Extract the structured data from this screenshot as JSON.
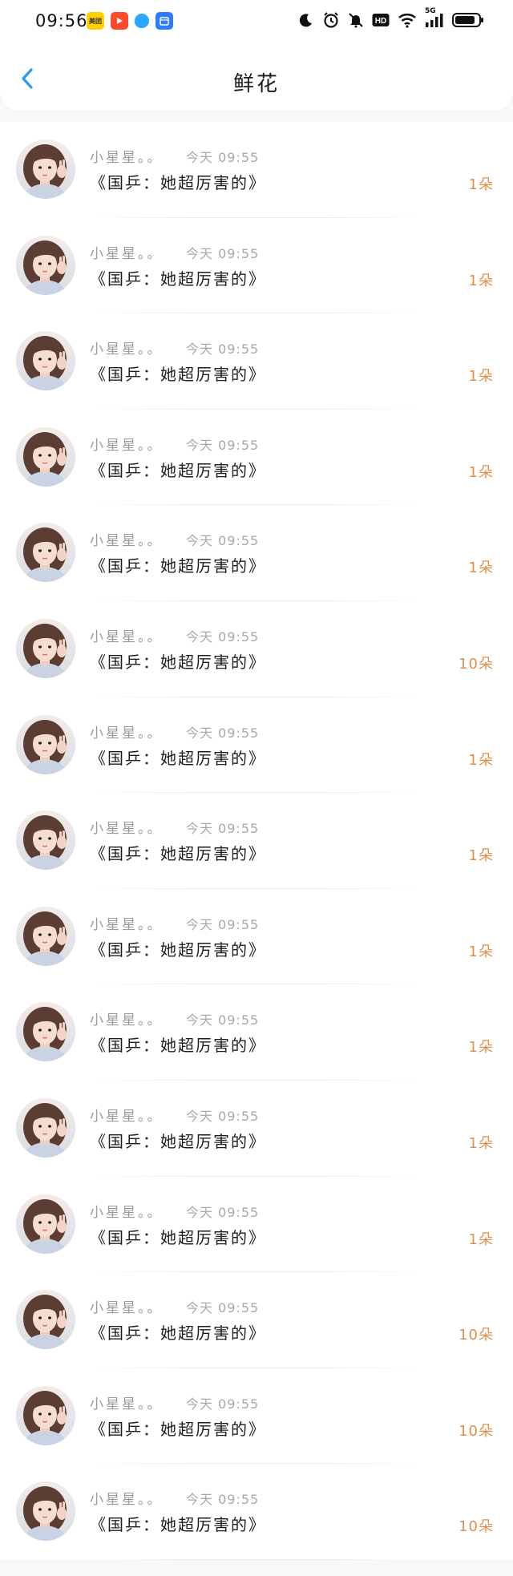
{
  "status_bar": {
    "time": "09:56",
    "app_icons": [
      {
        "name": "meituan-icon",
        "label": "美团"
      },
      {
        "name": "video-app-icon",
        "label": ""
      },
      {
        "name": "message-app-icon",
        "label": ""
      },
      {
        "name": "calendar-app-icon",
        "label": ""
      }
    ],
    "status_icons": [
      "moon-icon",
      "alarm-icon",
      "mute-icon",
      "hd-icon",
      "wifi-icon",
      "signal-icon",
      "battery-icon"
    ],
    "network_label": "5G",
    "hd_label": "HD"
  },
  "header": {
    "title": "鲜花",
    "back_icon": "chevron-left-icon",
    "accent_color": "#2a9bf5"
  },
  "colors": {
    "count": "#e0904a",
    "meta": "#9a9a9a",
    "title": "#1e1e1e"
  },
  "items": [
    {
      "user": "小星星。。",
      "time": "今天 09:55",
      "title": "《国乒：她超厉害的》",
      "count": "1朵"
    },
    {
      "user": "小星星。。",
      "time": "今天 09:55",
      "title": "《国乒：她超厉害的》",
      "count": "1朵"
    },
    {
      "user": "小星星。。",
      "time": "今天 09:55",
      "title": "《国乒：她超厉害的》",
      "count": "1朵"
    },
    {
      "user": "小星星。。",
      "time": "今天 09:55",
      "title": "《国乒：她超厉害的》",
      "count": "1朵"
    },
    {
      "user": "小星星。。",
      "time": "今天 09:55",
      "title": "《国乒：她超厉害的》",
      "count": "1朵"
    },
    {
      "user": "小星星。。",
      "time": "今天 09:55",
      "title": "《国乒：她超厉害的》",
      "count": "10朵"
    },
    {
      "user": "小星星。。",
      "time": "今天 09:55",
      "title": "《国乒：她超厉害的》",
      "count": "1朵"
    },
    {
      "user": "小星星。。",
      "time": "今天 09:55",
      "title": "《国乒：她超厉害的》",
      "count": "1朵"
    },
    {
      "user": "小星星。。",
      "time": "今天 09:55",
      "title": "《国乒：她超厉害的》",
      "count": "1朵"
    },
    {
      "user": "小星星。。",
      "time": "今天 09:55",
      "title": "《国乒：她超厉害的》",
      "count": "1朵"
    },
    {
      "user": "小星星。。",
      "time": "今天 09:55",
      "title": "《国乒：她超厉害的》",
      "count": "1朵"
    },
    {
      "user": "小星星。。",
      "time": "今天 09:55",
      "title": "《国乒：她超厉害的》",
      "count": "1朵"
    },
    {
      "user": "小星星。。",
      "time": "今天 09:55",
      "title": "《国乒：她超厉害的》",
      "count": "10朵"
    },
    {
      "user": "小星星。。",
      "time": "今天 09:55",
      "title": "《国乒：她超厉害的》",
      "count": "10朵"
    },
    {
      "user": "小星星。。",
      "time": "今天 09:55",
      "title": "《国乒：她超厉害的》",
      "count": "10朵"
    }
  ]
}
